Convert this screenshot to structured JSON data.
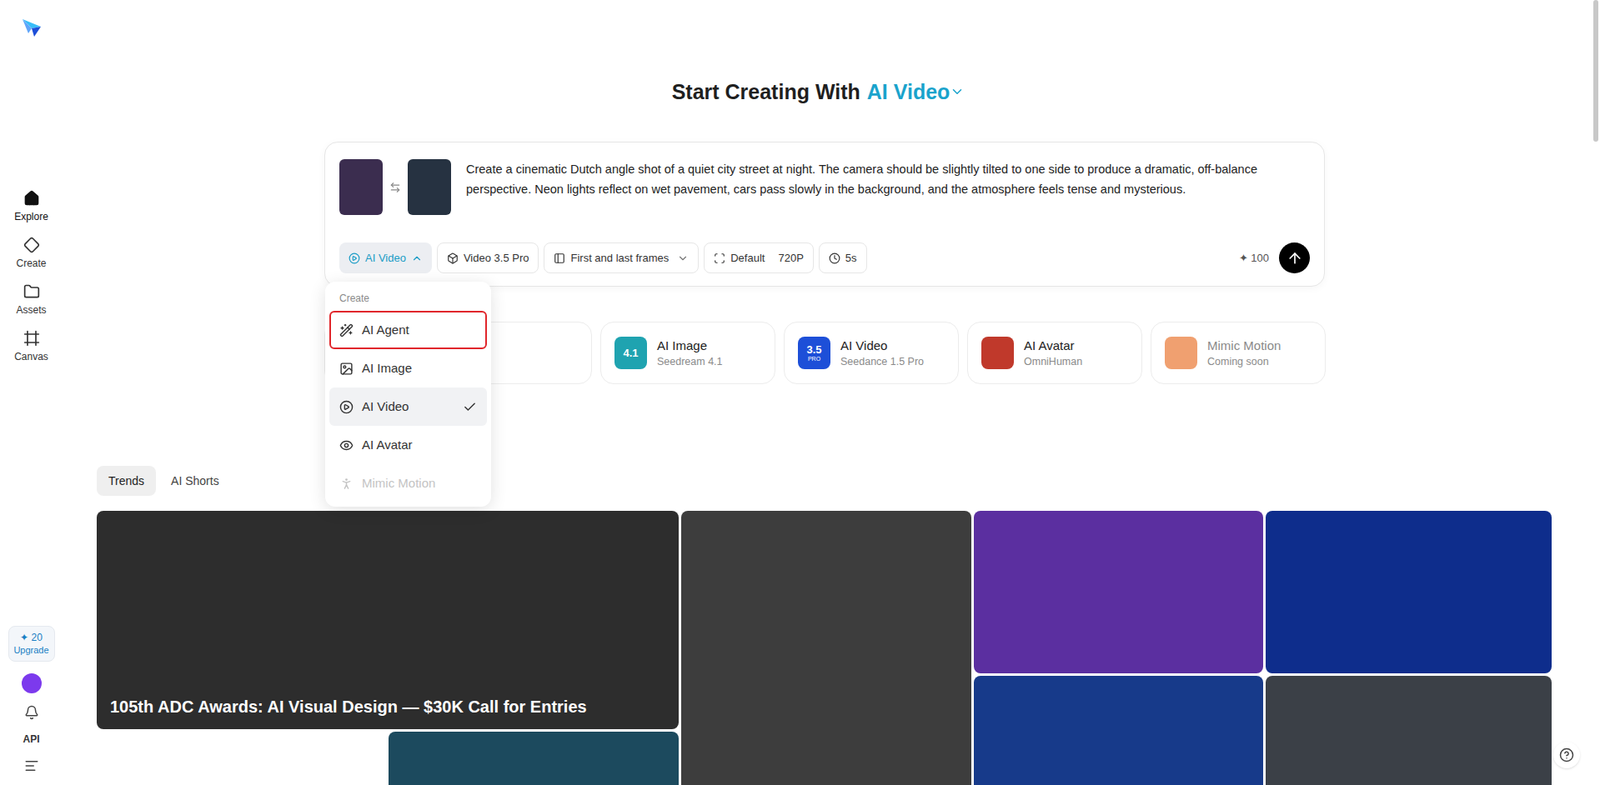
{
  "sidebar": {
    "items": [
      {
        "label": "Explore",
        "selected": true
      },
      {
        "label": "Create",
        "selected": false
      },
      {
        "label": "Assets",
        "selected": false
      },
      {
        "label": "Canvas",
        "selected": false
      }
    ],
    "credits": {
      "icon": "✦",
      "count": "20",
      "label": "Upgrade"
    },
    "avatar": {
      "color": "#7c3aed"
    },
    "api": "API"
  },
  "heading": {
    "prefix": "Start Creating With",
    "mode": "AI Video"
  },
  "prompt": {
    "thumbnails": [
      {
        "color": "#3b2d4f"
      },
      {
        "color": "#263241"
      }
    ],
    "text": "Create a cinematic Dutch angle shot of a quiet city street at night. The camera should be slightly tilted to one side to produce a dramatic, off-balance perspective. Neon lights reflect on wet pavement, cars pass slowly in the background, and the atmosphere feels tense and mysterious.",
    "toolbar": [
      {
        "label": "AI Video",
        "kind": "mode",
        "expanded": true
      },
      {
        "label": "Video 3.5 Pro",
        "kind": "model"
      },
      {
        "label": "First and last frames",
        "kind": "frames",
        "expanded": false
      },
      {
        "label": "Default",
        "value": "720P",
        "kind": "ratio"
      },
      {
        "label": "5s",
        "kind": "duration"
      }
    ],
    "cost": {
      "icon": "✦",
      "amount": "100"
    }
  },
  "menu": {
    "heading": "Create",
    "items": [
      {
        "label": "AI Agent",
        "selected": false,
        "highlighted": true,
        "disabled": false
      },
      {
        "label": "AI Image",
        "selected": false,
        "highlighted": false,
        "disabled": false
      },
      {
        "label": "AI Video",
        "selected": true,
        "highlighted": false,
        "disabled": false
      },
      {
        "label": "AI Avatar",
        "selected": false,
        "highlighted": false,
        "disabled": false
      },
      {
        "label": "Mimic Motion",
        "selected": false,
        "highlighted": false,
        "disabled": true
      }
    ]
  },
  "cards": [
    {
      "title": "AI Image",
      "subtitle": "Seedream 4.1",
      "color": "#1fa3b0",
      "badge": "4.1",
      "disabled": false
    },
    {
      "title": "AI Video",
      "subtitle": "Seedance 1.5 Pro",
      "color": "#1d4fd8",
      "badge": "3.5",
      "badge_note": "PRO",
      "disabled": false
    },
    {
      "title": "AI Avatar",
      "subtitle": "OmniHuman",
      "color": "#c0392b",
      "disabled": false
    },
    {
      "title": "Mimic Motion",
      "subtitle": "Coming soon",
      "color": "#f0a070",
      "disabled": true
    }
  ],
  "tabs": [
    {
      "label": "Trends",
      "selected": true
    },
    {
      "label": "AI Shorts",
      "selected": false
    }
  ],
  "gallery": [
    {
      "color": "#2d2d2d",
      "caption": "105th ADC Awards: AI Visual Design — $30K Call for Entries"
    },
    {
      "color": "#ffffff"
    },
    {
      "color": "#1c4a5e"
    },
    {
      "color": "#3d3d3d"
    },
    {
      "color": "#5b2fa0"
    },
    {
      "color": "#0e2d8c"
    },
    {
      "color": "#173a8a"
    },
    {
      "color": "#3b4047"
    }
  ]
}
